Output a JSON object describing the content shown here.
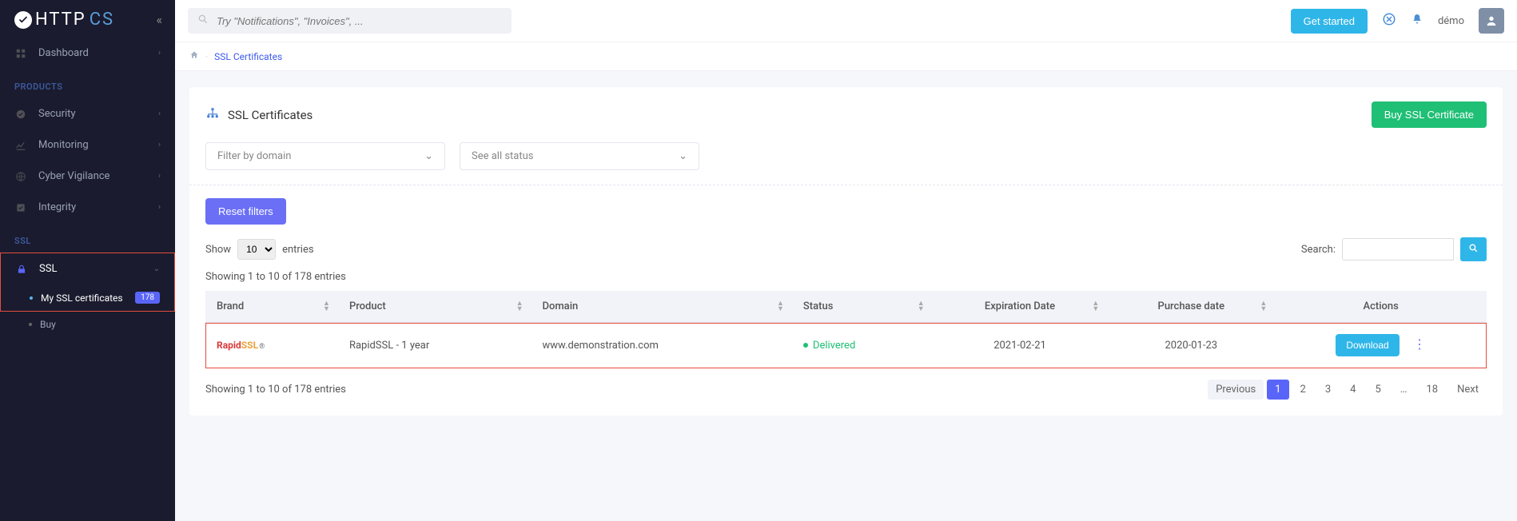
{
  "brand": {
    "name": "HTTP",
    "suffix": "CS"
  },
  "sidebar": {
    "dashboard": "Dashboard",
    "section_products": "PRODUCTS",
    "items": {
      "security": "Security",
      "monitoring": "Monitoring",
      "cyber": "Cyber Vigilance",
      "integrity": "Integrity"
    },
    "section_ssl": "SSL",
    "ssl_label": "SSL",
    "my_certs": "My SSL certificates",
    "my_certs_badge": "178",
    "buy": "Buy"
  },
  "topbar": {
    "search_placeholder": "Try \"Notifications\", \"Invoices\", ...",
    "get_started": "Get started",
    "user": "démo"
  },
  "crumb": {
    "current": "SSL Certificates"
  },
  "page": {
    "title": "SSL Certificates",
    "buy_button": "Buy SSL Certificate",
    "filter_domain": "Filter by domain",
    "filter_status": "See all status",
    "reset": "Reset filters",
    "show": "Show",
    "page_size": "10",
    "entries": "entries",
    "search": "Search:",
    "summary": "Showing 1 to 10 of 178 entries",
    "footer_summary": "Showing 1 to 10 of 178 entries",
    "pager": {
      "prev": "Previous",
      "next": "Next",
      "p1": "1",
      "p2": "2",
      "p3": "3",
      "p4": "4",
      "p5": "5",
      "ell": "…",
      "last": "18"
    }
  },
  "table": {
    "headers": {
      "brand": "Brand",
      "product": "Product",
      "domain": "Domain",
      "status": "Status",
      "expiration": "Expiration Date",
      "purchase": "Purchase date",
      "actions": "Actions"
    },
    "row": {
      "brand_rapid": "Rapid",
      "brand_ssl": "SSL",
      "brand_dot": "®",
      "product": "RapidSSL - 1 year",
      "domain": "www.demonstration.com",
      "status": "Delivered",
      "expiration": "2021-02-21",
      "purchase": "2020-01-23",
      "download": "Download"
    }
  }
}
